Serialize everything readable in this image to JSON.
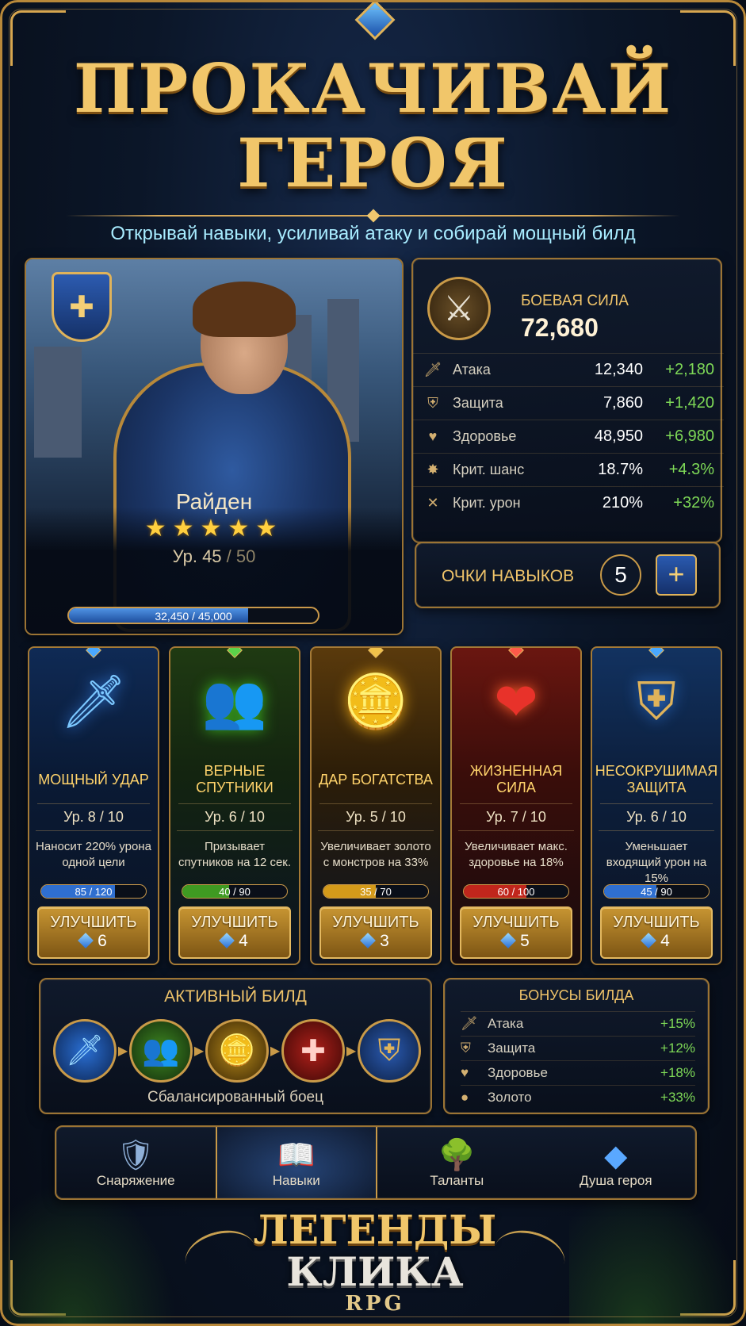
{
  "header": {
    "title_line1": "ПРОКАЧИВАЙ",
    "title_line2": "ГЕРОЯ",
    "subtitle": "Открывай навыки, усиливай атаку и собирай мощный билд"
  },
  "hero": {
    "name": "Райден",
    "stars": "★★★★★",
    "star_count": 5,
    "level_prefix": "Ур. 45",
    "level_max": " / 50",
    "xp_text": "32,450 / 45,000",
    "xp_fraction": 0.721,
    "badge_icon": "shield-icon"
  },
  "stats": {
    "power_label": "БОЕВАЯ СИЛА",
    "power_value": "72,680",
    "power_icon": "crossed-swords-icon",
    "rows": [
      {
        "icon": "sword-icon",
        "name": "Атака",
        "value": "12,340",
        "bonus": "+2,180"
      },
      {
        "icon": "shield-icon",
        "name": "Защита",
        "value": "7,860",
        "bonus": "+1,420"
      },
      {
        "icon": "heart-icon",
        "name": "Здоровье",
        "value": "48,950",
        "bonus": "+6,980"
      },
      {
        "icon": "crit-chance-icon",
        "name": "Крит. шанс",
        "value": "18.7%",
        "bonus": "+4.3%"
      },
      {
        "icon": "crit-damage-icon",
        "name": "Крит. урон",
        "value": "210%",
        "bonus": "+32%"
      }
    ]
  },
  "skill_points": {
    "label": "ОЧКИ НАВЫКОВ",
    "value": "5",
    "plus": "+"
  },
  "skills": [
    {
      "name": "МОЩНЫЙ УДАР",
      "level": "Ур. 8 / 10",
      "desc": "Наносит 220% урона одной цели",
      "progress": "85 / 120",
      "fraction": 0.708,
      "bar_color": "#2f6fd0",
      "button": "УЛУЧШИТЬ",
      "cost": "6",
      "icon": "glowing-sword-icon",
      "gem_color": "#4aa8ff"
    },
    {
      "name": "ВЕРНЫЕ СПУТНИКИ",
      "level": "Ур. 6 / 10",
      "desc": "Призывает спутников на 12 сек.",
      "progress": "40 / 90",
      "fraction": 0.444,
      "bar_color": "#3f9a22",
      "button": "УЛУЧШИТЬ",
      "cost": "4",
      "icon": "companions-icon",
      "gem_color": "#5bd24a"
    },
    {
      "name": "ДАР БОГАТСТВА",
      "level": "Ур. 5 / 10",
      "desc": "Увеличивает золото с монстров на 33%",
      "progress": "35 / 70",
      "fraction": 0.5,
      "bar_color": "#d49a1a",
      "button": "УЛУЧШИТЬ",
      "cost": "3",
      "icon": "gold-coins-icon",
      "gem_color": "#f1c24a"
    },
    {
      "name": "ЖИЗНЕННАЯ СИЛА",
      "level": "Ур. 7 / 10",
      "desc": "Увеличивает макс. здоровье на 18%",
      "progress": "60 / 100",
      "fraction": 0.6,
      "bar_color": "#c0261c",
      "button": "УЛУЧШИТЬ",
      "cost": "5",
      "icon": "heart-cross-icon",
      "gem_color": "#ff5a4a"
    },
    {
      "name": "НЕСОКРУШИМАЯ ЗАЩИТА",
      "level": "Ур. 6 / 10",
      "desc": "Уменьшает входящий урон на 15%",
      "progress": "45 / 90",
      "fraction": 0.5,
      "bar_color": "#2f6fd0",
      "button": "УЛУЧШИТЬ",
      "cost": "4",
      "icon": "shield-icon",
      "gem_color": "#4aa8ff"
    }
  ],
  "build": {
    "title": "АКТИВНЫЙ БИЛД",
    "description": "Сбалансированный боец",
    "icons": [
      "glowing-sword-icon",
      "companions-icon",
      "gold-coins-icon",
      "heart-cross-icon",
      "shield-icon"
    ]
  },
  "bonuses": {
    "title": "БОНУСЫ БИЛДА",
    "rows": [
      {
        "icon": "sword-icon",
        "name": "Атака",
        "value": "+15%"
      },
      {
        "icon": "shield-icon",
        "name": "Защита",
        "value": "+12%"
      },
      {
        "icon": "heart-icon",
        "name": "Здоровье",
        "value": "+18%"
      },
      {
        "icon": "gold-coin-icon",
        "name": "Золото",
        "value": "+33%"
      }
    ]
  },
  "nav": {
    "items": [
      {
        "label": "Снаряжение",
        "icon": "armor-icon",
        "active": false
      },
      {
        "label": "Навыки",
        "icon": "book-icon",
        "active": true
      },
      {
        "label": "Таланты",
        "icon": "tree-icon",
        "active": false
      },
      {
        "label": "Душа героя",
        "icon": "crystal-icon",
        "active": false
      }
    ]
  },
  "logo": {
    "line1": "ЛЕГЕНДЫ",
    "line2": "КЛИКА",
    "line3": "RPG"
  },
  "colors": {
    "gold": "#d7a64f",
    "bonus_green": "#7ed957",
    "subtitle_cyan": "#a8ecff"
  }
}
